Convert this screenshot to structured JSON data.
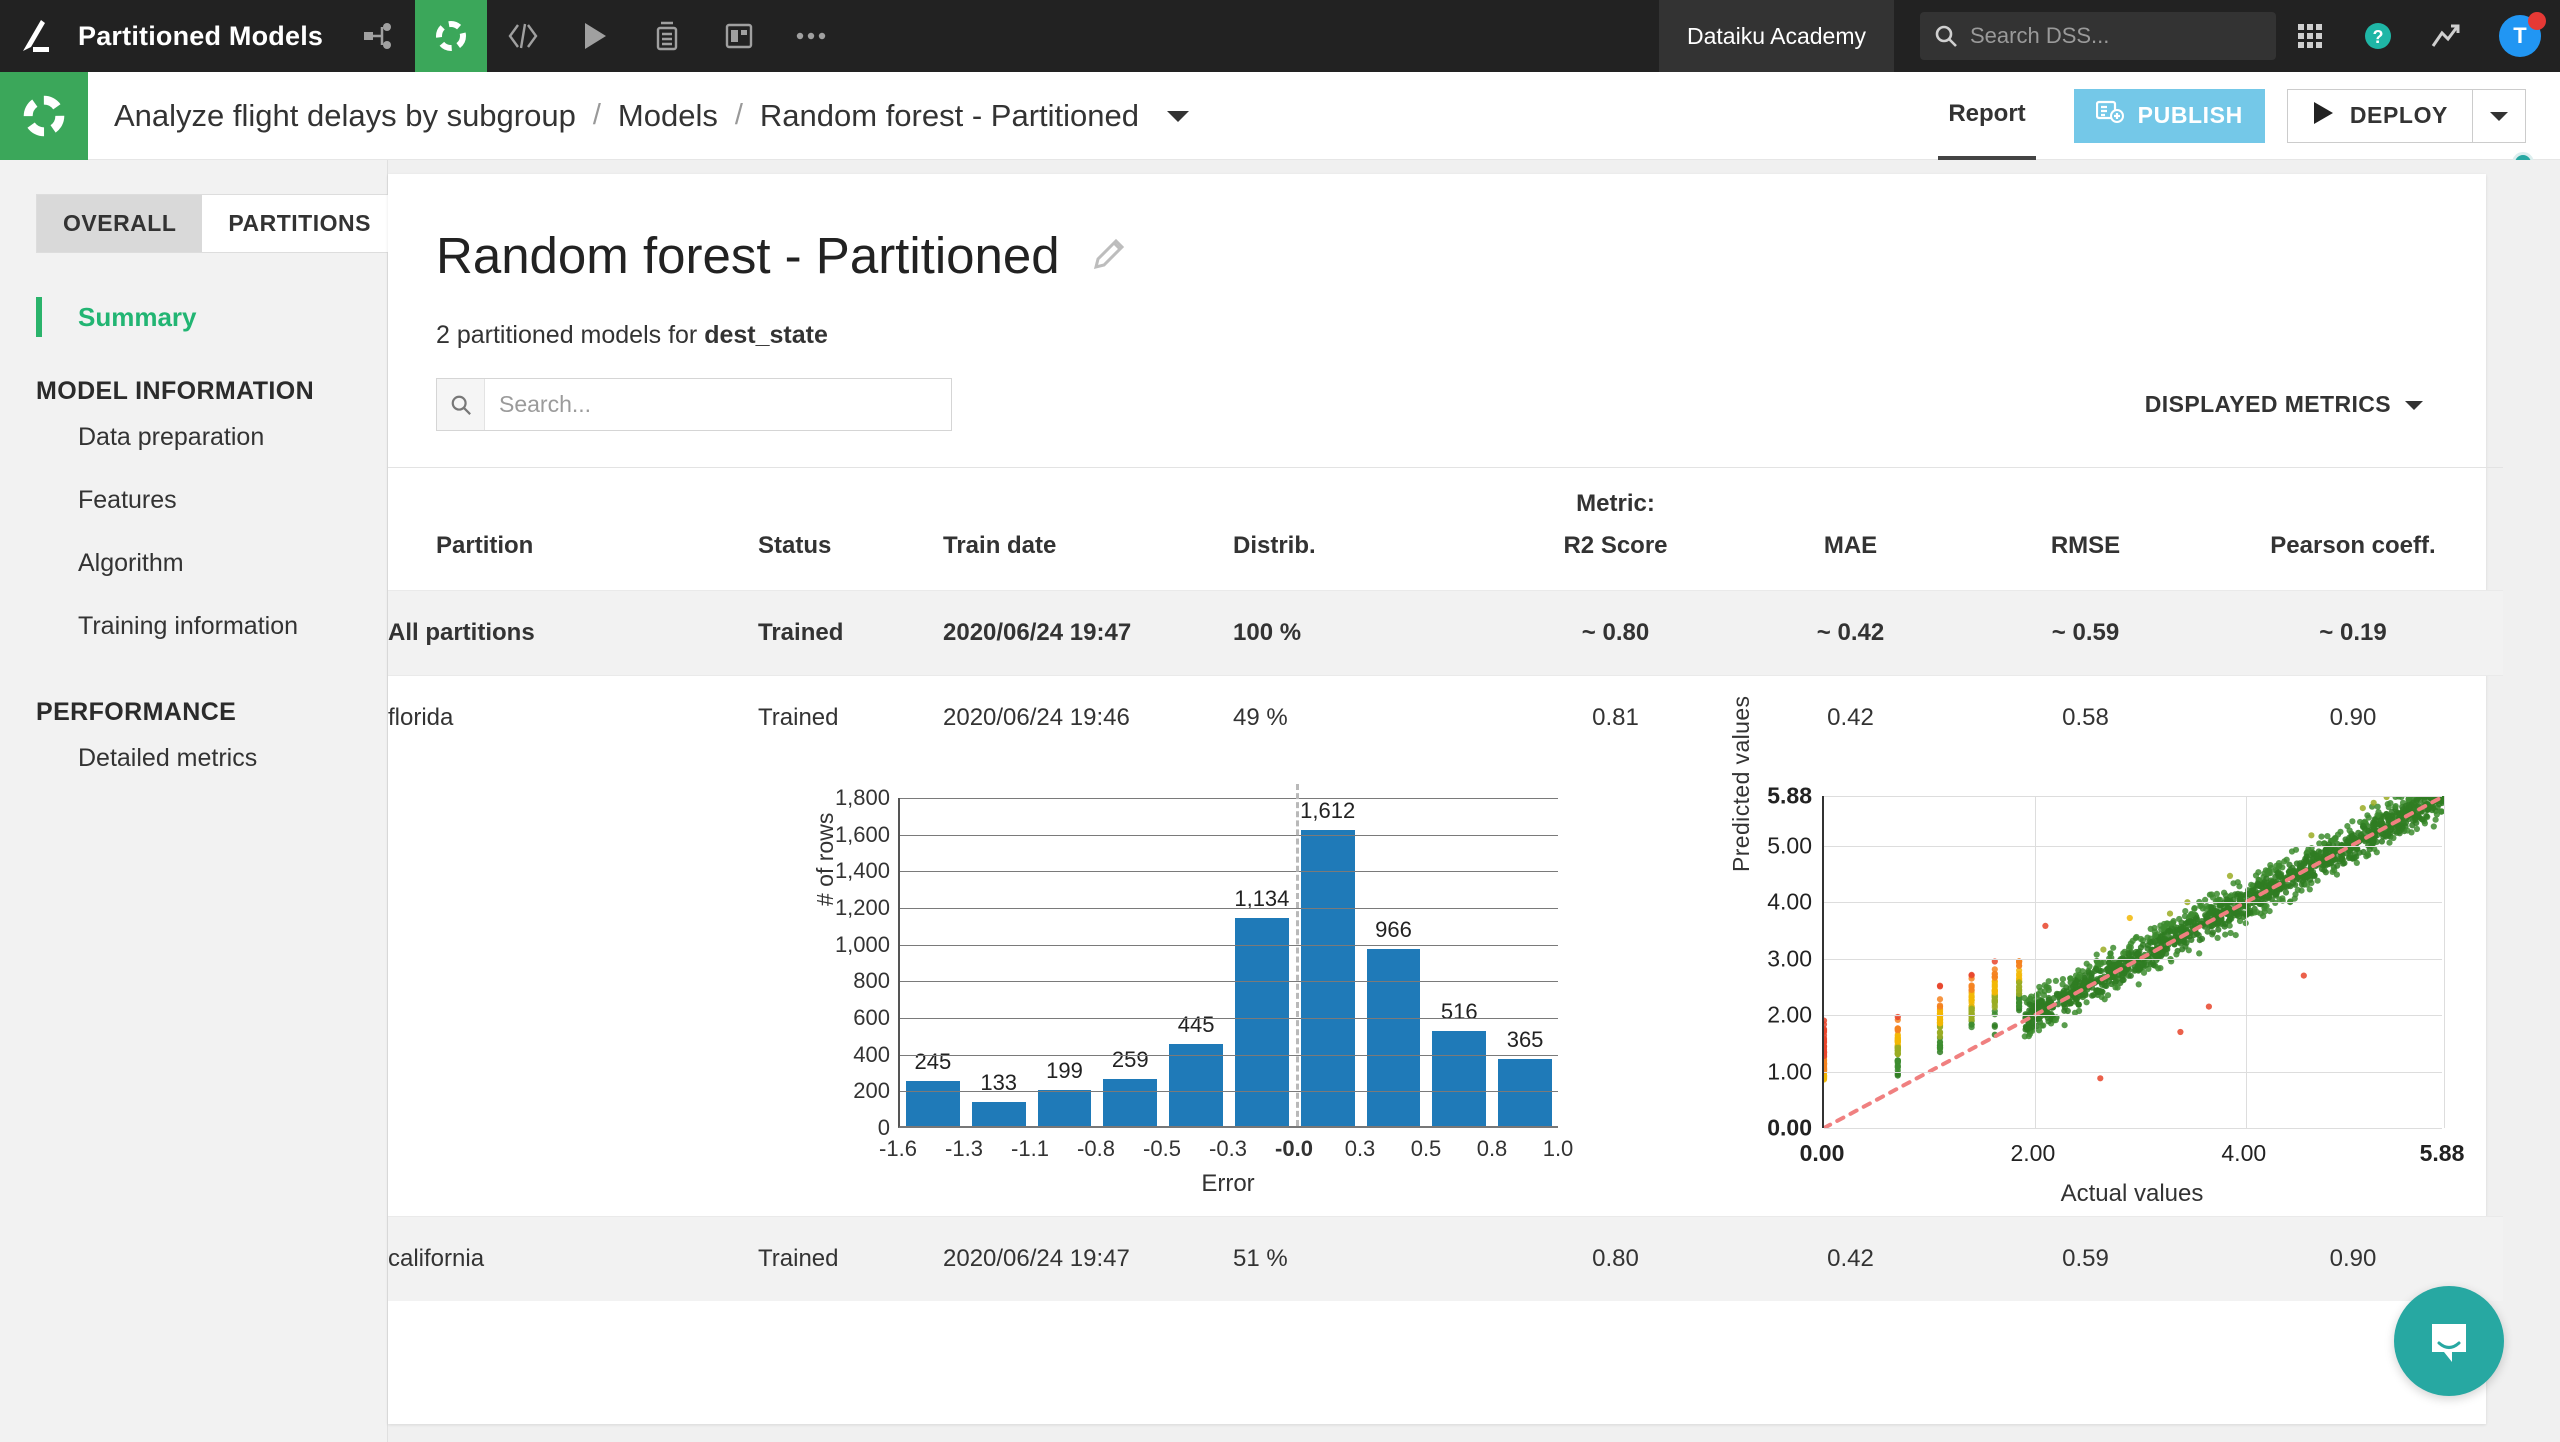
{
  "topnav": {
    "logo_icon": "dataiku-bird-icon",
    "project_name": "Partitioned Models",
    "icons": [
      {
        "name": "flow-icon",
        "glyph": "flow"
      },
      {
        "name": "lab-icon",
        "glyph": "lab",
        "active": true
      },
      {
        "name": "code-icon",
        "glyph": "code"
      },
      {
        "name": "jobs-icon",
        "glyph": "play"
      },
      {
        "name": "notebooks-icon",
        "glyph": "notebook"
      },
      {
        "name": "dashboards-icon",
        "glyph": "dashboard"
      },
      {
        "name": "more-icon",
        "glyph": "ellipsis"
      }
    ],
    "academy_label": "Dataiku Academy",
    "search_placeholder": "Search DSS...",
    "search_value": "",
    "apps_icon": "grid-apps-icon",
    "help_icon": "help-circle-icon",
    "activity_icon": "trending-up-icon",
    "avatar_initial": "T",
    "avatar_color": "#2196f3",
    "badge_color": "#e53935"
  },
  "breadcrumb": {
    "logo_icon": "lab-circle-icon",
    "project": "Analyze flight delays by subgroup",
    "sep": "/",
    "section": "Models",
    "current": "Random forest - Partitioned",
    "caret_icon": "chevron-down-icon",
    "report_tab": "Report",
    "publish_label": "PUBLISH",
    "publish_icon": "publish-dashboard-icon",
    "publish_color": "#74c8e8",
    "deploy_label": "DEPLOY",
    "deploy_icon": "play-icon",
    "deploy_caret_icon": "chevron-down-icon"
  },
  "sidebar": {
    "tabs": [
      {
        "label": "OVERALL",
        "selected": false
      },
      {
        "label": "PARTITIONS",
        "selected": true
      }
    ],
    "active_item": "Summary",
    "active_color": "#22b573",
    "groups": [
      {
        "heading": "MODEL INFORMATION",
        "items": [
          "Data preparation",
          "Features",
          "Algorithm",
          "Training information"
        ]
      },
      {
        "heading": "PERFORMANCE",
        "items": [
          "Detailed metrics"
        ]
      }
    ]
  },
  "main": {
    "title": "Random forest - Partitioned",
    "edit_icon": "pencil-icon",
    "subtitle_prefix": "2 partitioned models for ",
    "subtitle_strong": "dest_state",
    "search_placeholder": "Search...",
    "search_value": "",
    "search_icon": "search-icon",
    "displayed_metrics_label": "DISPLAYED METRICS",
    "displayed_metrics_caret": "chevron-down-icon"
  },
  "table": {
    "metric_group_label": "Metric:",
    "columns": [
      "Partition",
      "Status",
      "Train date",
      "Distrib.",
      "R2 Score",
      "MAE",
      "RMSE",
      "Pearson coeff."
    ],
    "rows": [
      {
        "partition": "All partitions",
        "status": "Trained",
        "train_date": "2020/06/24 19:47",
        "distrib": "100 %",
        "r2": "~ 0.80",
        "mae": "~ 0.42",
        "rmse": "~ 0.59",
        "pearson": "~ 0.19",
        "shaded": true,
        "bold": true
      },
      {
        "partition": "florida",
        "status": "Trained",
        "train_date": "2020/06/24 19:46",
        "distrib": "49 %",
        "r2": "0.81",
        "mae": "0.42",
        "rmse": "0.58",
        "pearson": "0.90",
        "shaded": false,
        "bold": false
      },
      {
        "partition": "california",
        "status": "Trained",
        "train_date": "2020/06/24 19:47",
        "distrib": "51 %",
        "r2": "0.80",
        "mae": "0.42",
        "rmse": "0.59",
        "pearson": "0.90",
        "shaded": true,
        "bold": false
      }
    ]
  },
  "chart_data": [
    {
      "type": "bar",
      "title": "",
      "xlabel": "Error",
      "ylabel": "# of rows",
      "categories": [
        "-1.6",
        "-1.3",
        "-1.1",
        "-0.8",
        "-0.5",
        "-0.3",
        "-0.0",
        "0.3",
        "0.5",
        "0.8",
        "1.0"
      ],
      "bin_edges": [
        -1.6,
        -1.3,
        -1.1,
        -0.8,
        -0.5,
        -0.3,
        -0.0,
        0.3,
        0.5,
        0.8,
        1.0
      ],
      "values": [
        245,
        133,
        199,
        259,
        445,
        1134,
        1612,
        966,
        516,
        365
      ],
      "data_labels": [
        "245",
        "133",
        "199",
        "259",
        "445",
        "1,134",
        "1,612",
        "966",
        "516",
        "365"
      ],
      "ylim": [
        0,
        1800
      ],
      "yticks": [
        0,
        200,
        400,
        600,
        800,
        1000,
        1200,
        1400,
        1600,
        1800
      ],
      "ytick_labels": [
        "0",
        "200",
        "400",
        "600",
        "800",
        "1,000",
        "1,200",
        "1,400",
        "1,600",
        "1,800"
      ],
      "bar_color": "#1f7ab8",
      "reference_line": {
        "x": "-0.0",
        "style": "dashed",
        "color": "#b9b9b9"
      },
      "grid": true,
      "legend": "none"
    },
    {
      "type": "scatter",
      "title": "",
      "xlabel": "Actual values",
      "ylabel": "Predicted values",
      "xlim": [
        0.0,
        5.88
      ],
      "ylim": [
        0.0,
        5.88
      ],
      "xtick_labels": [
        "0.00",
        "2.00",
        "4.00",
        "5.88"
      ],
      "xticks": [
        0.0,
        2.0,
        4.0,
        5.88
      ],
      "ytick_labels": [
        "0.00",
        "1.00",
        "2.00",
        "3.00",
        "4.00",
        "5.00",
        "5.88"
      ],
      "yticks": [
        0.0,
        1.0,
        2.0,
        3.0,
        4.0,
        5.0,
        5.88
      ],
      "diagonal_line": {
        "from": [
          0.0,
          0.0
        ],
        "to": [
          5.88,
          5.88
        ],
        "style": "dotted",
        "color": "#f08080"
      },
      "point_colormap": [
        "#e8442a",
        "#f58220",
        "#f2b705",
        "#9aab23",
        "#3d8c2f",
        "#2f7d22"
      ],
      "grid": true,
      "legend": "none",
      "note": "Predicted-vs-actual scatter; points colored red (large error) to green (small error)"
    }
  ],
  "chat": {
    "icon": "chat-bubble-icon",
    "color": "#27a8a2"
  }
}
